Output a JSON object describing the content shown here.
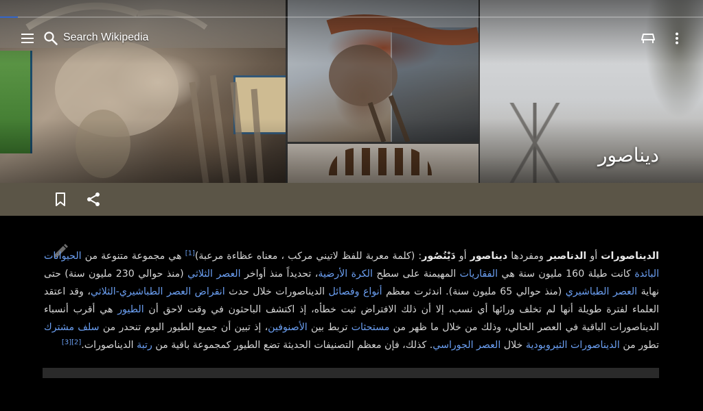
{
  "toolbar": {
    "search_placeholder": "Search Wikipedia",
    "menu_icon": "menu-icon",
    "search_icon": "search-icon",
    "reading_list_icon": "reading-list-icon",
    "overflow_icon": "more-vert-icon"
  },
  "loading_progress": 0.025,
  "article": {
    "title": "ديناصور",
    "actions": {
      "bookmark_icon": "bookmark-icon",
      "share_icon": "share-icon"
    },
    "edit_icon": "edit-pencil-icon",
    "lead": {
      "t1_bold": "الديناصورات",
      "t2": " أو ",
      "t3_bold": "الدناصير",
      "t4": " ومفردها ",
      "t5_bold": "ديناصور",
      "t6": " أو ",
      "t7_bold": "دَيْنُصُور",
      "t8": ": (كلمة معربة للفظ لاتيني مركب ، معناه عظاءة مرعبة)",
      "ref1": "[1]",
      "t9": " هي مجموعة متنوعة من ",
      "l1": "الحيوانات البائدة",
      "t10": " كانت طيلة 160 مليون سنة هي ",
      "l2": "الفقاريات",
      "t11": " المهيمنة على سطح ",
      "l3": "الكرة الأرضية",
      "t12": "، تحديداً منذ أواخر ",
      "l4": "العصر الثلاثي",
      "t13": " (منذ حوالي 230 مليون سنة) حتى نهاية ",
      "l5": "العصر الطباشيري",
      "t14": " (منذ حوالي 65 مليون سنة). اندثرت معظم ",
      "l6": "أنواع وفصائل",
      "t15": " الديناصورات خلال حدث ",
      "l7": "انقراض العصر الطباشيري-الثلاثي",
      "t16": "، وقد اعتقد العلماء لفترة طويلة أنها لم تخلف ورائها أي نسب، إلا أن ذلك الافتراض ثبت خطأه، إذ اكتشف الباحثون في وقت لاحق أن ",
      "l8": "الطيور",
      "t17": " هي أقرب أنسباء الديناصورات الباقية في العصر الحالي، وذلك من خلال ما ظهر من ",
      "l9": "مستحثات",
      "t18": " تربط بين ",
      "l10": "الأصنوفين",
      "t19": "، إذ تبين أن جميع الطيور اليوم تنحدر من ",
      "l11": "سلف مشترك",
      "t20": " تطور من ",
      "l12": "الديناصورات الثيروبودية",
      "t21": " خلال ",
      "l13": "العصر الجوراسي",
      "t22": ". كذلك، فإن معظم التصنيفات الحديثة تضع الطيور كمجموعة باقية من ",
      "l14": "رتبة",
      "t23": " الديناصورات.",
      "ref2": "[2]",
      "ref3": "[3]"
    }
  },
  "colors": {
    "action_bar": "#5b5547",
    "link": "#6b9ff2",
    "body_text": "#d6d6d6",
    "background": "#000000",
    "progress": "#3366cc"
  }
}
